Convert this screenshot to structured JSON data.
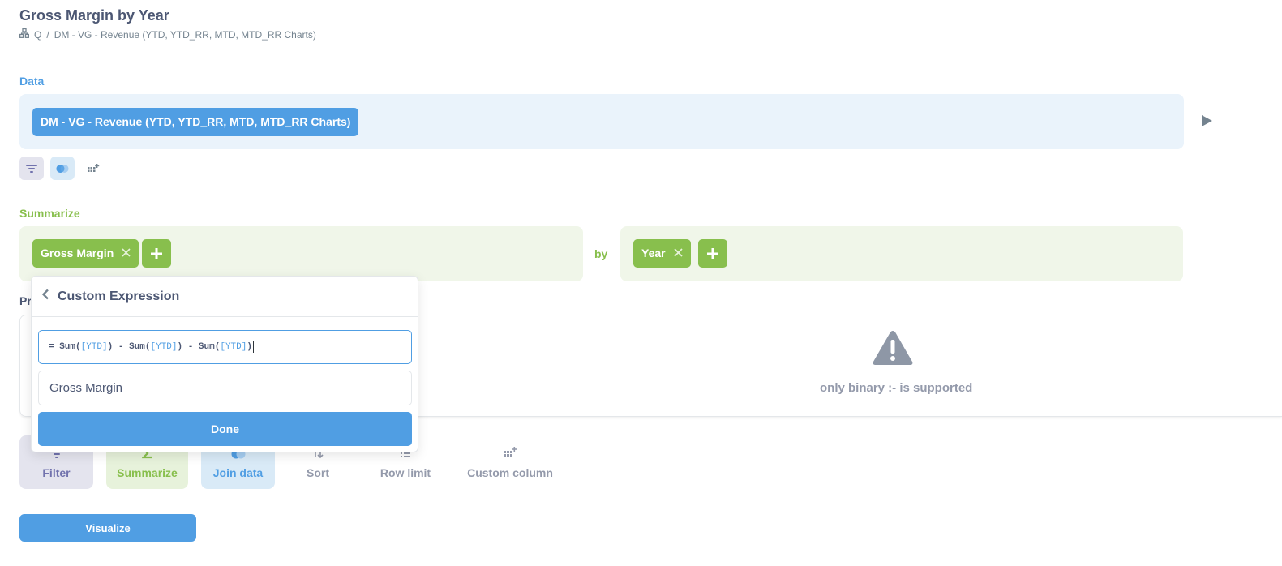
{
  "header": {
    "title": "Gross Margin by Year",
    "breadcrumb": {
      "icon": "collection-icon",
      "collection": "Q",
      "separator": "/",
      "source": "DM - VG - Revenue (YTD, YTD_RR, MTD, MTD_RR Charts)"
    }
  },
  "data_section": {
    "label": "Data",
    "source_label": "DM - VG - Revenue (YTD, YTD_RR, MTD, MTD_RR Charts)",
    "step_icons": [
      "filter-icon",
      "join-icon",
      "custom-column-icon"
    ]
  },
  "summarize_section": {
    "label": "Summarize",
    "metric": "Gross Margin",
    "by_label": "by",
    "breakout": "Year"
  },
  "preview_section": {
    "label_fragment": "Pr",
    "error": "only binary :- is supported"
  },
  "actions": [
    {
      "label": "Filter",
      "icon": "filter-icon"
    },
    {
      "label": "Summarize",
      "icon": "sigma-icon"
    },
    {
      "label": "Join data",
      "icon": "join-icon"
    },
    {
      "label": "Sort",
      "icon": "sort-icon"
    },
    {
      "label": "Row limit",
      "icon": "row-limit-icon"
    },
    {
      "label": "Custom column",
      "icon": "custom-column-icon"
    }
  ],
  "visualize_label": "Visualize",
  "popover": {
    "title": "Custom Expression",
    "expression": {
      "prefix": "= ",
      "fn": "Sum",
      "field": "[YTD]",
      "op": " - "
    },
    "name_value": "Gross Margin",
    "done_label": "Done"
  },
  "colors": {
    "brand": "#509ee3",
    "summarize": "#88bf4d",
    "filter": "#7172ad",
    "text": "#4c5773",
    "muted": "#949aab"
  }
}
